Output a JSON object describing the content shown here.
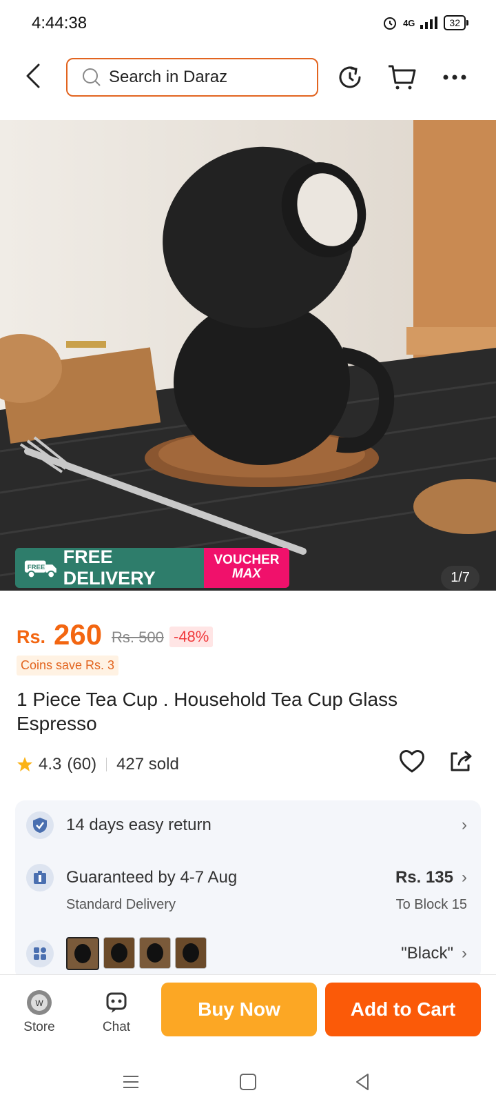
{
  "status_bar": {
    "time": "4:44:38",
    "network": "4G",
    "battery": "32"
  },
  "search": {
    "placeholder": "Search in Daraz"
  },
  "gallery": {
    "counter": "1/7",
    "free_delivery": "FREE DELIVERY",
    "free_tag": "FREE",
    "voucher_line1": "VOUCHER",
    "voucher_line2": "MAX"
  },
  "price": {
    "currency": "Rs.",
    "value": "260",
    "original": "Rs. 500",
    "discount": "-48%",
    "coins": "Coins save Rs. 3"
  },
  "product": {
    "title": "1 Piece Tea Cup . Household Tea Cup Glass Espresso",
    "rating": "4.3",
    "reviews": "(60)",
    "sold": "427 sold"
  },
  "info": {
    "return": "14 days easy return",
    "delivery": "Guaranteed by 4-7 Aug",
    "delivery_type": "Standard Delivery",
    "delivery_price": "Rs. 135",
    "delivery_to": "To Block 15",
    "variant": "\"Black\""
  },
  "bottom": {
    "store": "Store",
    "chat": "Chat",
    "buy_now": "Buy Now",
    "add_to_cart": "Add to Cart"
  },
  "colors": {
    "accent": "#f36611",
    "buy": "#fca724",
    "cart": "#fb5a08",
    "free_delivery": "#2e7d6b",
    "voucher": "#f0116b"
  }
}
